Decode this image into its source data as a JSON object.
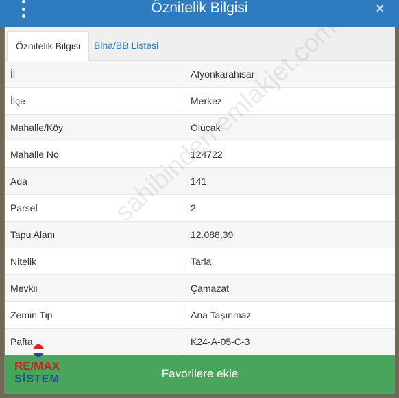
{
  "header": {
    "title": "Öznitelik Bilgisi",
    "close_label": "×",
    "menu_icon": "kebab-vertical-icon"
  },
  "tabs": [
    {
      "label": "Öznitelik Bilgisi",
      "active": true
    },
    {
      "label": "Bina/BB Listesi",
      "active": false
    }
  ],
  "rows": [
    {
      "key": "İl",
      "value": "Afyonkarahisar"
    },
    {
      "key": "İlçe",
      "value": "Merkez"
    },
    {
      "key": "Mahalle/Köy",
      "value": "Olucak"
    },
    {
      "key": "Mahalle No",
      "value": "124722"
    },
    {
      "key": "Ada",
      "value": "141"
    },
    {
      "key": "Parsel",
      "value": "2"
    },
    {
      "key": "Tapu Alanı",
      "value": "12.088,39"
    },
    {
      "key": "Nitelik",
      "value": "Tarla"
    },
    {
      "key": "Mevkii",
      "value": "Çamazat"
    },
    {
      "key": "Zemin Tip",
      "value": "Ana Taşınmaz"
    },
    {
      "key": "Pafta",
      "value": "K24-A-05-C-3"
    }
  ],
  "favorites_button": "Favorilere ekle",
  "watermark": "sahibinden emlakjet.com",
  "logo": {
    "line1": "RE/MAX",
    "line2": "SİSTEM"
  },
  "colors": {
    "header": "#2f7bbf",
    "button": "#4aa55c",
    "link": "#337ab7"
  }
}
